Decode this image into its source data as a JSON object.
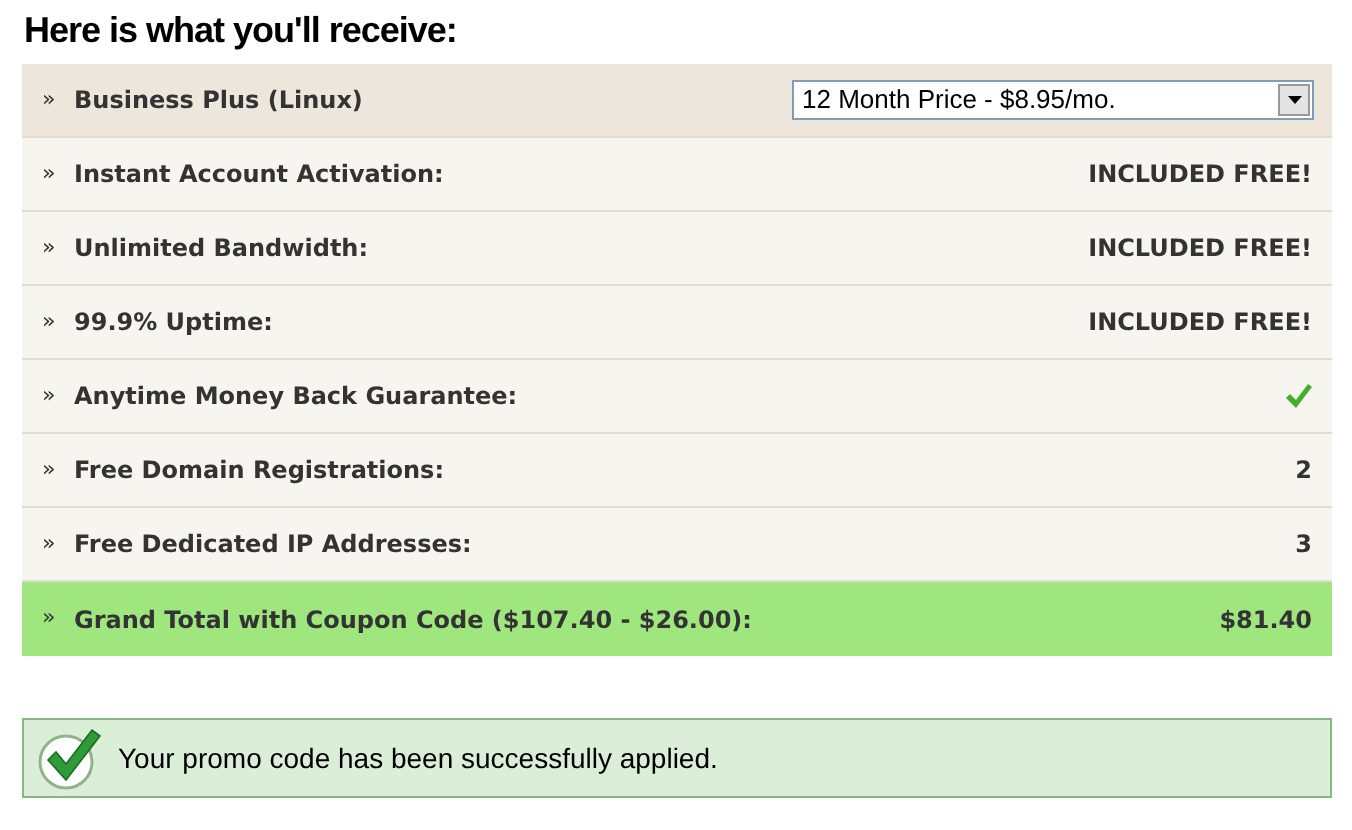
{
  "heading": "Here is what you'll receive:",
  "rows": [
    {
      "kind": "plan",
      "marker": "»",
      "label": "Business Plus (Linux)",
      "select": {
        "value": "12 Month Price - $8.95/mo."
      }
    },
    {
      "kind": "text",
      "marker": "»",
      "label": "Instant Account Activation:",
      "value": "INCLUDED FREE!"
    },
    {
      "kind": "text",
      "marker": "»",
      "label": "Unlimited Bandwidth:",
      "value": "INCLUDED FREE!"
    },
    {
      "kind": "text",
      "marker": "»",
      "label": "99.9% Uptime:",
      "value": "INCLUDED FREE!"
    },
    {
      "kind": "check",
      "marker": "»",
      "label": "Anytime Money Back Guarantee:",
      "checked": true
    },
    {
      "kind": "text",
      "marker": "»",
      "label": "Free Domain Registrations:",
      "value": "2"
    },
    {
      "kind": "text",
      "marker": "»",
      "label": "Free Dedicated IP Addresses:",
      "value": "3"
    },
    {
      "kind": "total",
      "marker": "»",
      "label": "Grand Total with Coupon Code ($107.40 - $26.00):",
      "value": "$81.40"
    }
  ],
  "message": {
    "kind": "success",
    "text": "Your promo code has been successfully applied."
  }
}
